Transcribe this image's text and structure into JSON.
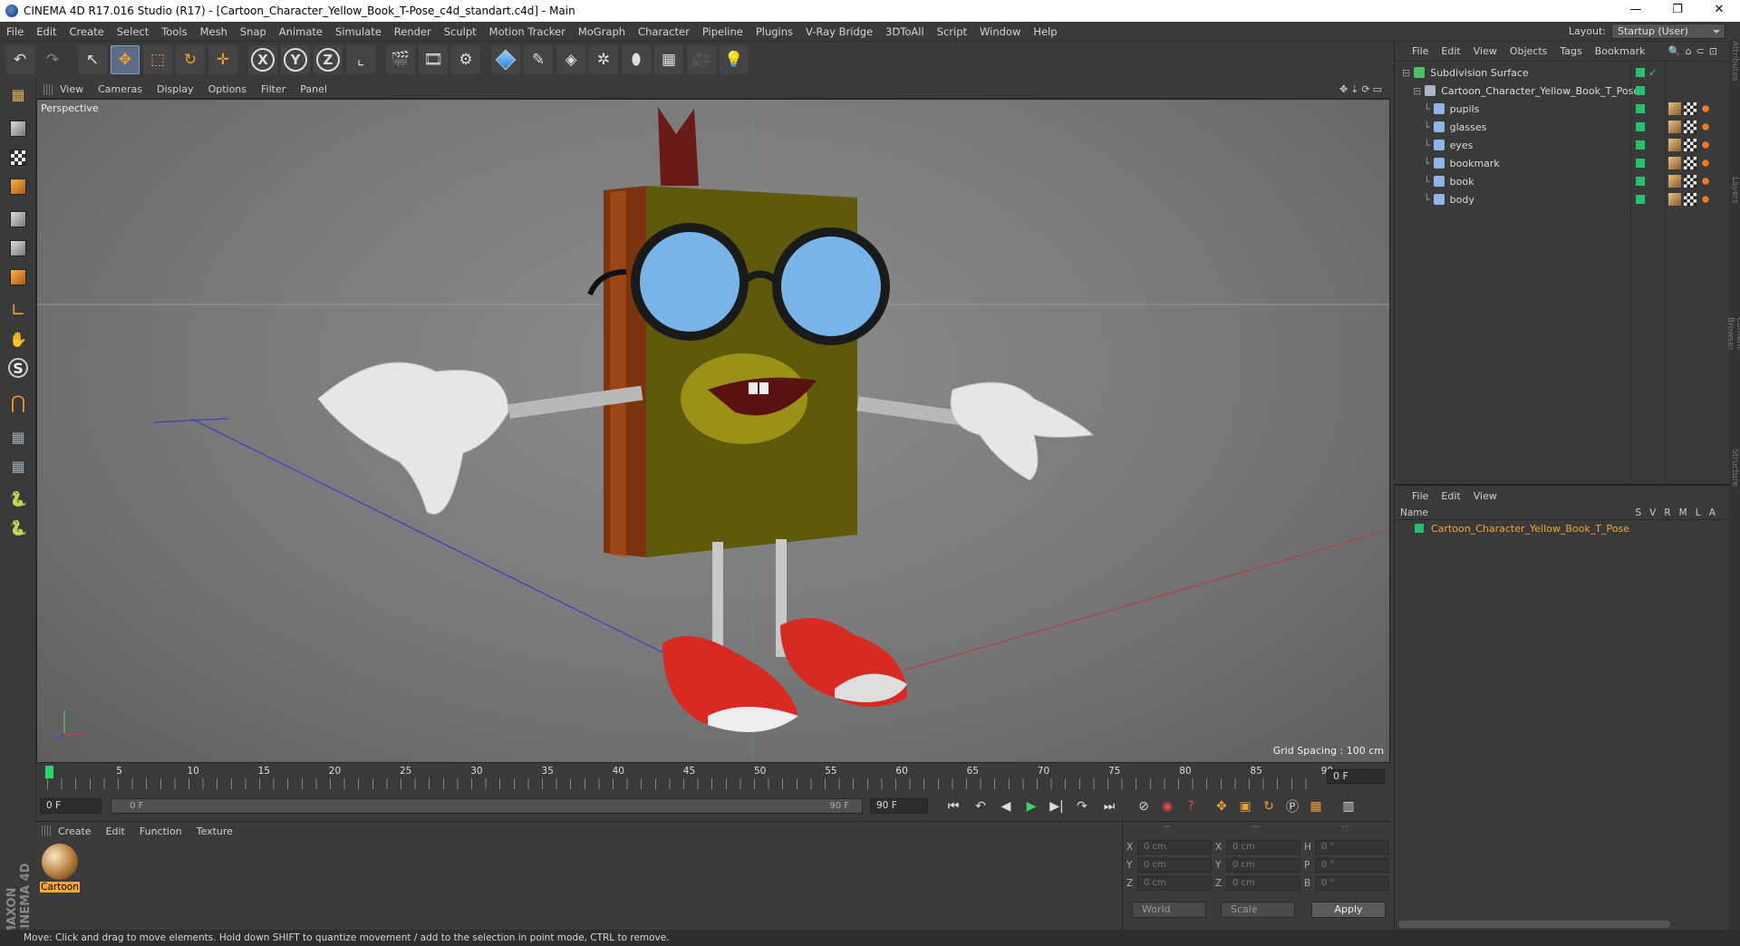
{
  "window": {
    "title": "CINEMA 4D R17.016 Studio (R17) - [Cartoon_Character_Yellow_Book_T-Pose_c4d_standart.c4d] - Main",
    "controls": [
      "—",
      "❐",
      "✕"
    ]
  },
  "menubar": {
    "items": [
      "File",
      "Edit",
      "Create",
      "Select",
      "Tools",
      "Mesh",
      "Snap",
      "Animate",
      "Simulate",
      "Render",
      "Sculpt",
      "Motion Tracker",
      "MoGraph",
      "Character",
      "Pipeline",
      "Plugins",
      "V-Ray Bridge",
      "3DToAll",
      "Script",
      "Window",
      "Help"
    ],
    "layout_label": "Layout:",
    "layout_value": "Startup (User)"
  },
  "toolbar": {
    "buttons": [
      {
        "name": "undo-icon",
        "glyph": "↶"
      },
      {
        "name": "redo-icon",
        "glyph": "↷"
      },
      {
        "name": "select-arrow-icon",
        "glyph": "↖"
      },
      {
        "name": "move-icon",
        "glyph": "✥"
      },
      {
        "name": "scale-icon",
        "glyph": "⬚"
      },
      {
        "name": "rotate-icon",
        "glyph": "↻"
      },
      {
        "name": "live-select-icon",
        "glyph": "✛"
      },
      {
        "name": "x-axis-icon",
        "glyph": "X"
      },
      {
        "name": "y-axis-icon",
        "glyph": "Y"
      },
      {
        "name": "z-axis-icon",
        "glyph": "Z"
      },
      {
        "name": "coordinate-system-icon",
        "glyph": "⌞"
      },
      {
        "name": "render-view-icon",
        "glyph": "🎬"
      },
      {
        "name": "render-picture-viewer-icon",
        "glyph": "🎞"
      },
      {
        "name": "render-settings-icon",
        "glyph": "⚙"
      },
      {
        "name": "cube-primitive-icon",
        "glyph": ""
      },
      {
        "name": "pen-spline-icon",
        "glyph": "✎"
      },
      {
        "name": "subdivision-surface-icon",
        "glyph": "◈"
      },
      {
        "name": "cloner-icon",
        "glyph": "✲"
      },
      {
        "name": "deformer-icon",
        "glyph": "⬮"
      },
      {
        "name": "floor-icon",
        "glyph": "▦"
      },
      {
        "name": "camera-icon",
        "glyph": "🎥"
      },
      {
        "name": "light-icon",
        "glyph": "💡"
      }
    ]
  },
  "viewport": {
    "menu": [
      "View",
      "Cameras",
      "Display",
      "Options",
      "Filter",
      "Panel"
    ],
    "label": "Perspective",
    "grid_spacing": "Grid Spacing : 100 cm",
    "nav_icons": "✥⇣⟳▭"
  },
  "timeline": {
    "ticks": [
      "0",
      "5",
      "10",
      "15",
      "20",
      "25",
      "30",
      "35",
      "40",
      "45",
      "50",
      "55",
      "60",
      "65",
      "70",
      "75",
      "80",
      "85",
      "90"
    ],
    "current_frame": "0 F"
  },
  "playbar": {
    "start": "0 F",
    "slider_start": "0 F",
    "slider_end": "90 F",
    "end": "90 F"
  },
  "material_manager": {
    "menu": [
      "Create",
      "Edit",
      "Function",
      "Texture"
    ],
    "materials": [
      {
        "name": "Cartoon"
      }
    ]
  },
  "brand": "MAXON CINEMA 4D",
  "coordinates": {
    "headers": [
      "--",
      "--",
      "--"
    ],
    "rows": [
      {
        "a": "X",
        "av": "0 cm",
        "b": "X",
        "bv": "0 cm",
        "c": "H",
        "cv": "0 °"
      },
      {
        "a": "Y",
        "av": "0 cm",
        "b": "Y",
        "bv": "0 cm",
        "c": "P",
        "cv": "0 °"
      },
      {
        "a": "Z",
        "av": "0 cm",
        "b": "Z",
        "bv": "0 cm",
        "c": "B",
        "cv": "0 °"
      }
    ],
    "mode": "World",
    "transform": "Scale",
    "apply": "Apply"
  },
  "object_manager": {
    "menu": [
      "File",
      "Edit",
      "View",
      "Objects",
      "Tags",
      "Bookmark"
    ],
    "objects": [
      {
        "name": "Subdivision Surface",
        "indent": 0,
        "icon": "subdivision-icon",
        "color": "#4fc06a"
      },
      {
        "name": "Cartoon_Character_Yellow_Book_T_Pose",
        "indent": 1,
        "icon": "null-object-icon",
        "color": "#aab4c4"
      },
      {
        "name": "pupils",
        "indent": 2,
        "icon": "polygon-object-icon",
        "color": "#8fb4e8"
      },
      {
        "name": "glasses",
        "indent": 2,
        "icon": "polygon-object-icon",
        "color": "#8fb4e8"
      },
      {
        "name": "eyes",
        "indent": 2,
        "icon": "polygon-object-icon",
        "color": "#8fb4e8"
      },
      {
        "name": "bookmark",
        "indent": 2,
        "icon": "polygon-object-icon",
        "color": "#8fb4e8"
      },
      {
        "name": "book",
        "indent": 2,
        "icon": "polygon-object-icon",
        "color": "#8fb4e8"
      },
      {
        "name": "body",
        "indent": 2,
        "icon": "polygon-object-icon",
        "color": "#8fb4e8"
      }
    ]
  },
  "layer_manager": {
    "menu": [
      "File",
      "Edit",
      "View"
    ],
    "name_header": "Name",
    "columns": "SVRMLA",
    "layers": [
      {
        "name": "Cartoon_Character_Yellow_Book_T_Pose"
      }
    ]
  },
  "side_tabs": [
    "Attributes",
    "Layers",
    "Content Browser",
    "Structure"
  ],
  "status": "Move: Click and drag to move elements. Hold down SHIFT to quantize movement / add to the selection in point mode, CTRL to remove."
}
